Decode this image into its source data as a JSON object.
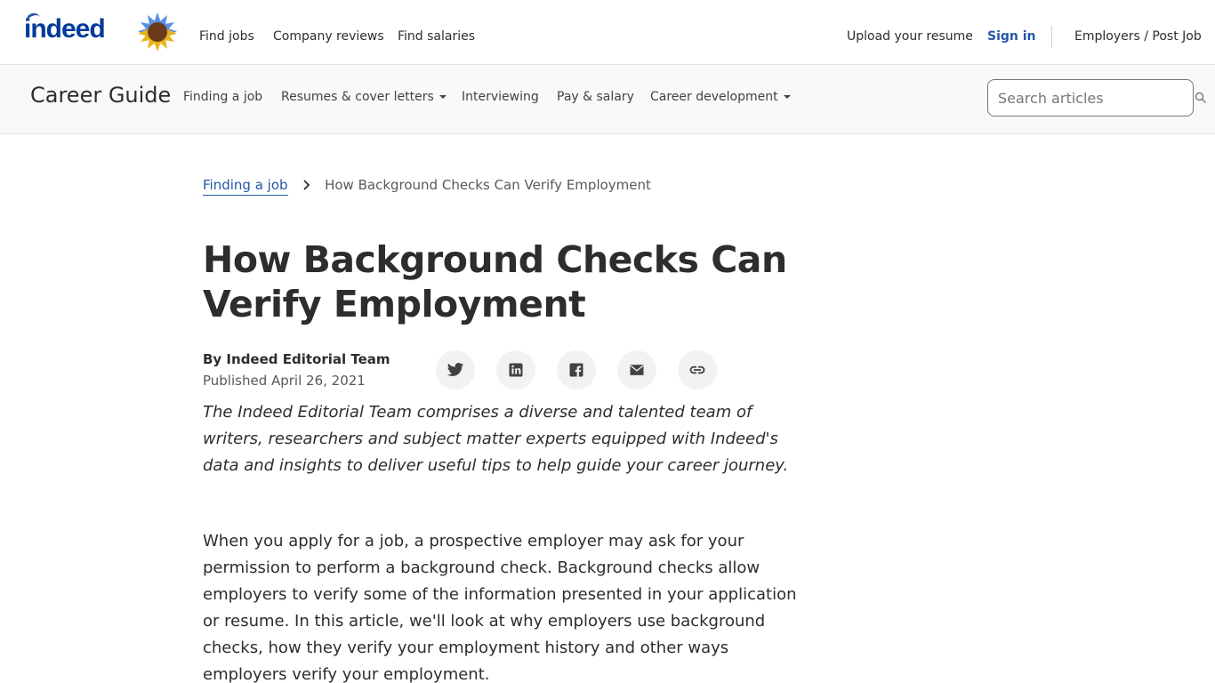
{
  "header": {
    "logo_text": "indeed",
    "nav": [
      {
        "label": "Find jobs"
      },
      {
        "label": "Company reviews"
      },
      {
        "label": "Find salaries"
      }
    ],
    "upload_resume": "Upload your resume",
    "sign_in": "Sign in",
    "employers": "Employers / Post Job"
  },
  "guide_bar": {
    "title": "Career Guide",
    "links": [
      {
        "label": "Finding a job",
        "has_dropdown": false
      },
      {
        "label": "Resumes & cover letters",
        "has_dropdown": true
      },
      {
        "label": "Interviewing",
        "has_dropdown": false
      },
      {
        "label": "Pay & salary",
        "has_dropdown": false
      },
      {
        "label": "Career development",
        "has_dropdown": true
      }
    ],
    "search": {
      "placeholder": "Search articles",
      "value": ""
    }
  },
  "breadcrumb": {
    "parent": "Finding a job",
    "current": "How Background Checks Can Verify Employment"
  },
  "article": {
    "title": "How Background Checks Can Verify Employment",
    "byline": "By Indeed Editorial Team",
    "published": "Published April 26, 2021",
    "share_icons": [
      "twitter-icon",
      "linkedin-icon",
      "facebook-icon",
      "email-icon",
      "link-icon"
    ],
    "author_bio": "The Indeed Editorial Team comprises a diverse and talented team of writers, researchers and subject matter experts equipped with Indeed's data and insights to deliver useful tips to help guide your career journey.",
    "intro": "When you apply for a job, a prospective employer may ask for your permission to perform a background check. Background checks allow employers to verify some of the information presented in your application or resume. In this article, we'll look at why employers use background checks, how they verify your employment history and other ways employers verify your employment."
  },
  "colors": {
    "brand_blue": "#2557a7",
    "logo_blue": "#003a9b",
    "text": "#2d2d2d",
    "muted": "#595959",
    "guide_bg": "#faf9f8",
    "share_bg": "#f3f2f1"
  }
}
